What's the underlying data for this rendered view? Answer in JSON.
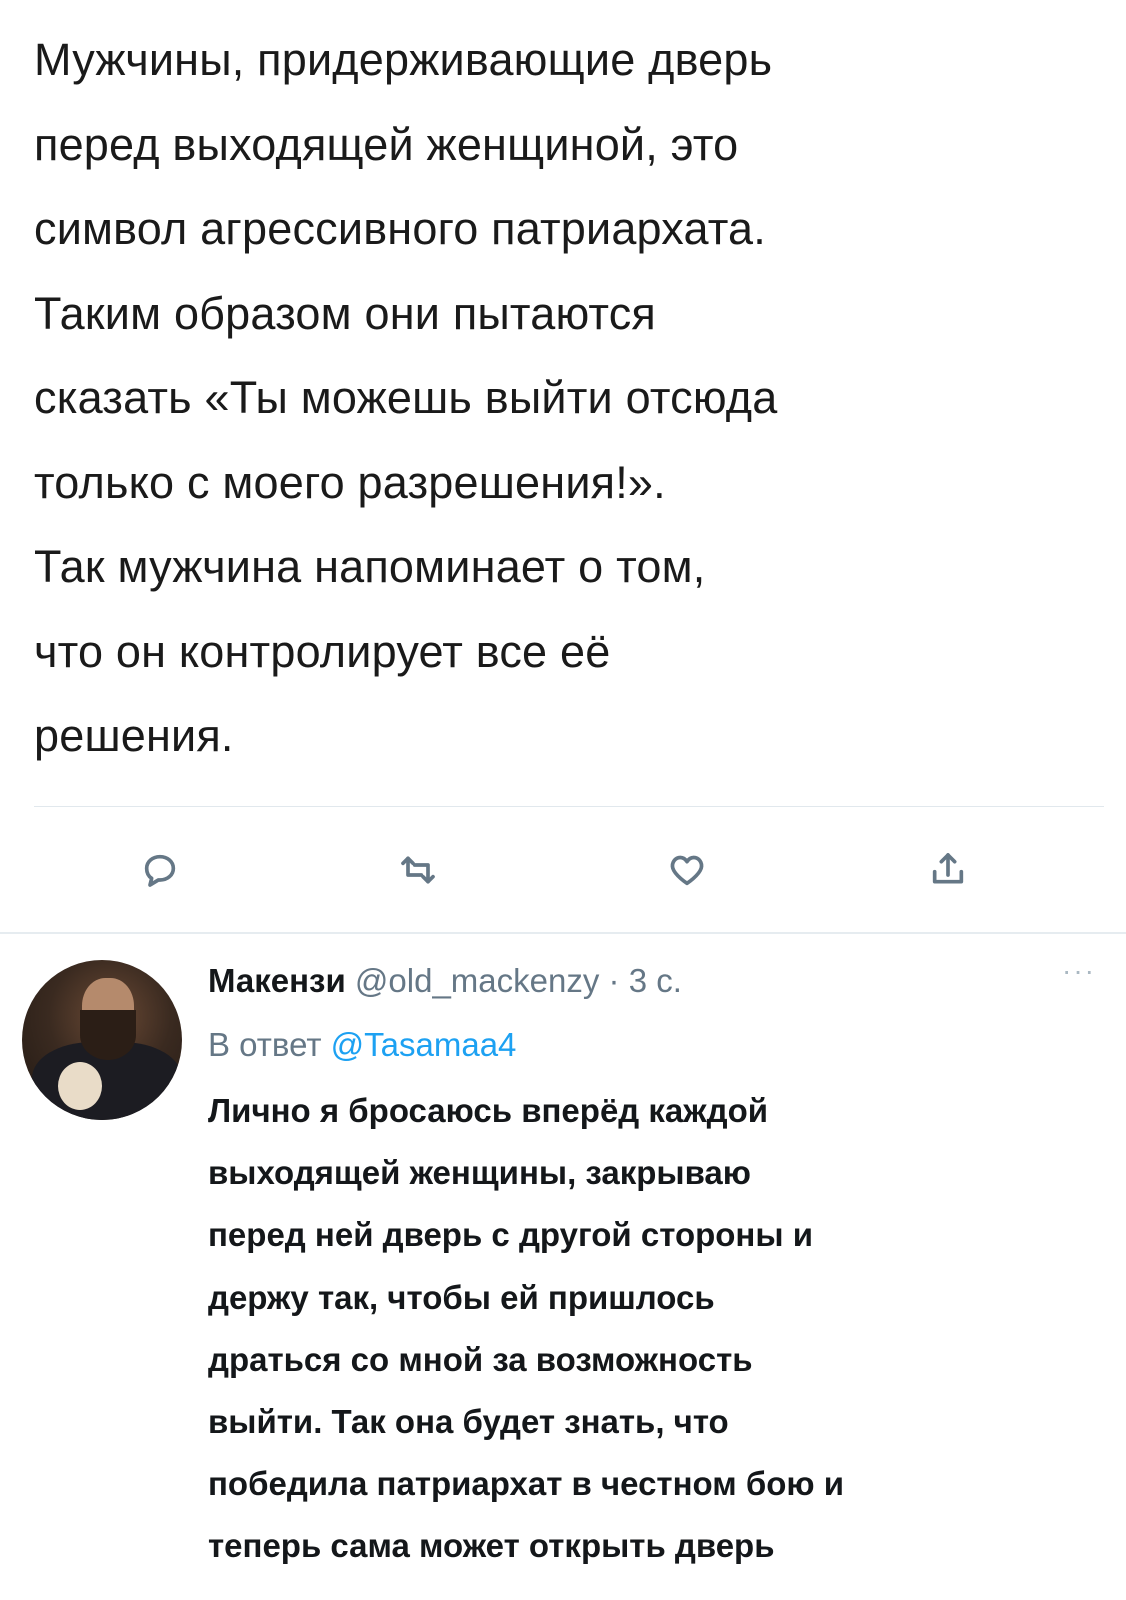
{
  "main_tweet": {
    "lines": [
      "Мужчины, придерживающие дверь",
      "перед выходящей женщиной, это",
      "символ агрессивного патриархата.",
      "Таким образом они пытаются",
      "сказать «Ты можешь выйти отсюда",
      "только с моего разрешения!».",
      "Так мужчина напоминает о том,",
      "что он контролирует все её",
      "решения."
    ]
  },
  "actions": {
    "reply_icon": "reply-icon",
    "retweet_icon": "retweet-icon",
    "like_icon": "heart-icon",
    "share_icon": "share-icon"
  },
  "reply": {
    "author": "Макензи",
    "handle": "@old_mackenzy",
    "separator": "·",
    "time": "3 с.",
    "reply_to_prefix": "В ответ",
    "reply_to_handle": "@Tasamaa4",
    "more": "···",
    "lines": [
      "Лично я бросаюсь вперёд каждой",
      "выходящей женщины, закрываю",
      "перед ней дверь с другой стороны и",
      "держу так, чтобы ей пришлось",
      "драться со мной за возможность",
      "выйти. Так она будет знать, что",
      "победила патриархат в честном бою и",
      "теперь сама может открыть дверь"
    ]
  },
  "colors": {
    "text": "#14171a",
    "secondary": "#657786",
    "link": "#1da1f2",
    "divider": "#e1e8ed"
  }
}
